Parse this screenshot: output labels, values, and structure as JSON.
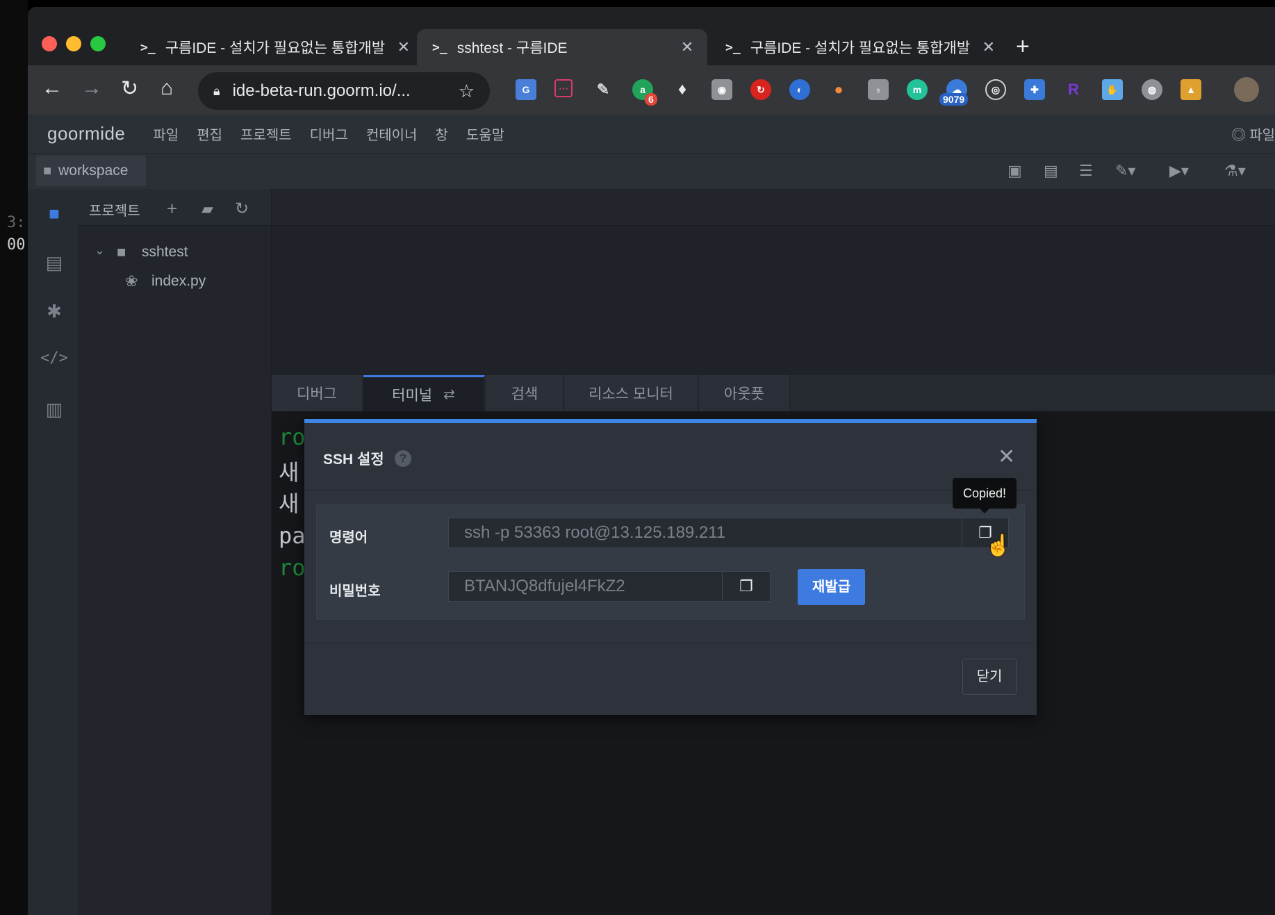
{
  "browser": {
    "tabs": [
      {
        "title": "구름IDE - 설치가 필요없는 통합개발",
        "active": false
      },
      {
        "title": "sshtest - 구름IDE",
        "active": true
      },
      {
        "title": "구름IDE - 설치가 필요없는 통합개발",
        "active": false
      }
    ],
    "terminal_icon": ">_",
    "url": "ide-beta-run.goorm.io/...",
    "extension_badges": {
      "first": "6",
      "second": "9079"
    }
  },
  "ide": {
    "logo": "goormide",
    "menu": [
      "파일",
      "편집",
      "프로젝트",
      "디버그",
      "컨테이너",
      "창",
      "도움말"
    ],
    "menu_right": "파일",
    "workspace_label": "workspace",
    "project_panel": {
      "title": "프로젝트",
      "tree": {
        "folder": "sshtest",
        "file": "index.py"
      }
    },
    "bottom_tabs": [
      "디버그",
      "터미널",
      "검색",
      "리소스 모니터",
      "아웃풋"
    ],
    "terminal_fragments": [
      "ro",
      "새",
      "새",
      "pa",
      "ro"
    ],
    "left_window_fragments": [
      "3:",
      "00"
    ]
  },
  "dialog": {
    "title": "SSH 설정",
    "command_label": "명령어",
    "command_value": "ssh -p 53363 root@13.125.189.211",
    "password_label": "비밀번호",
    "password_value": "BTANJQ8dfujel4FkZ2",
    "reissue_label": "재발급",
    "close_label": "닫기",
    "tooltip": "Copied!"
  },
  "colors": {
    "accent": "#3d7be0",
    "terminal_green": "#1f8a3a",
    "terminal_text": "#c0c4ca"
  }
}
